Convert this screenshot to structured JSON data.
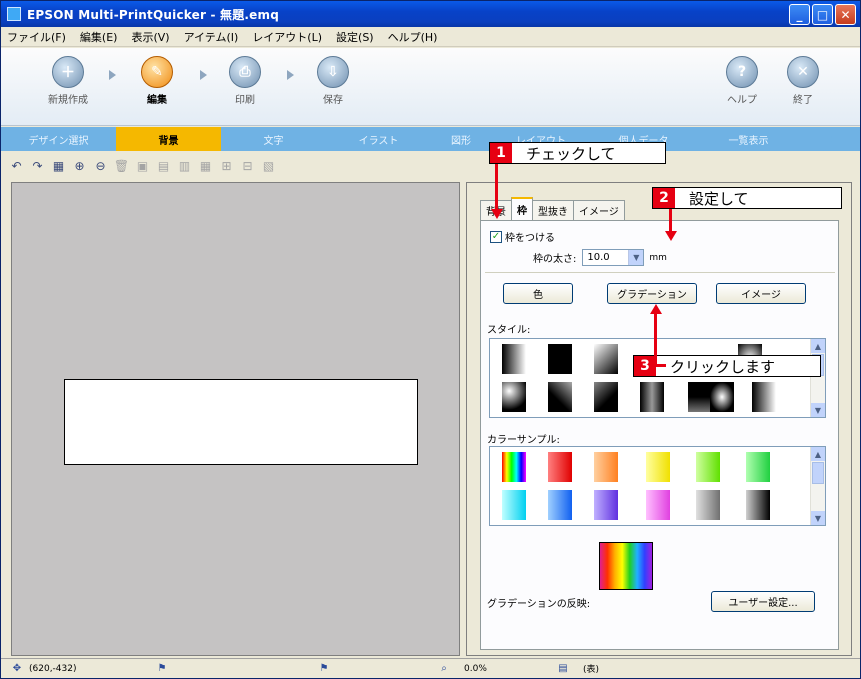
{
  "window": {
    "title": "EPSON Multi-PrintQuicker - 無題.emq"
  },
  "menu": [
    "ファイル(F)",
    "編集(E)",
    "表示(V)",
    "アイテム(I)",
    "レイアウト(L)",
    "設定(S)",
    "ヘルプ(H)"
  ],
  "toolbar": {
    "new": "新規作成",
    "edit": "編集",
    "print": "印刷",
    "save": "保存",
    "help": "ヘルプ",
    "exit": "終了"
  },
  "tabs": [
    "デザイン選択",
    "背景",
    "文字",
    "イラスト",
    "図形",
    "レイアウト",
    "個人データ",
    "一覧表示"
  ],
  "selected_tab": "背景",
  "panel": {
    "tabs": [
      "背景",
      "枠",
      "型抜き",
      "イメージ"
    ],
    "checkbox_label": "枠をつける",
    "thickness_label": "枠の太さ:",
    "thickness_value": "10.0",
    "thickness_unit": "mm",
    "btn_color": "色",
    "btn_gradation": "グラデーション",
    "btn_image": "イメージ",
    "style_label": "スタイル:",
    "color_sample_label": "カラーサンプル:",
    "grad_reflect_label": "グラデーションの反映:",
    "user_setting_btn": "ユーザー設定..."
  },
  "annotations": [
    {
      "num": "1",
      "text": "チェックして"
    },
    {
      "num": "2",
      "text": "設定して"
    },
    {
      "num": "3",
      "text": "クリックします"
    }
  ],
  "status": {
    "coords": "(620,-432)",
    "zoom": "0.0%",
    "side": "(表)"
  },
  "colors": {
    "accent_tab": "#f5b800",
    "annotation_red": "#e60012",
    "tabstrip": "#6fb2e4"
  }
}
